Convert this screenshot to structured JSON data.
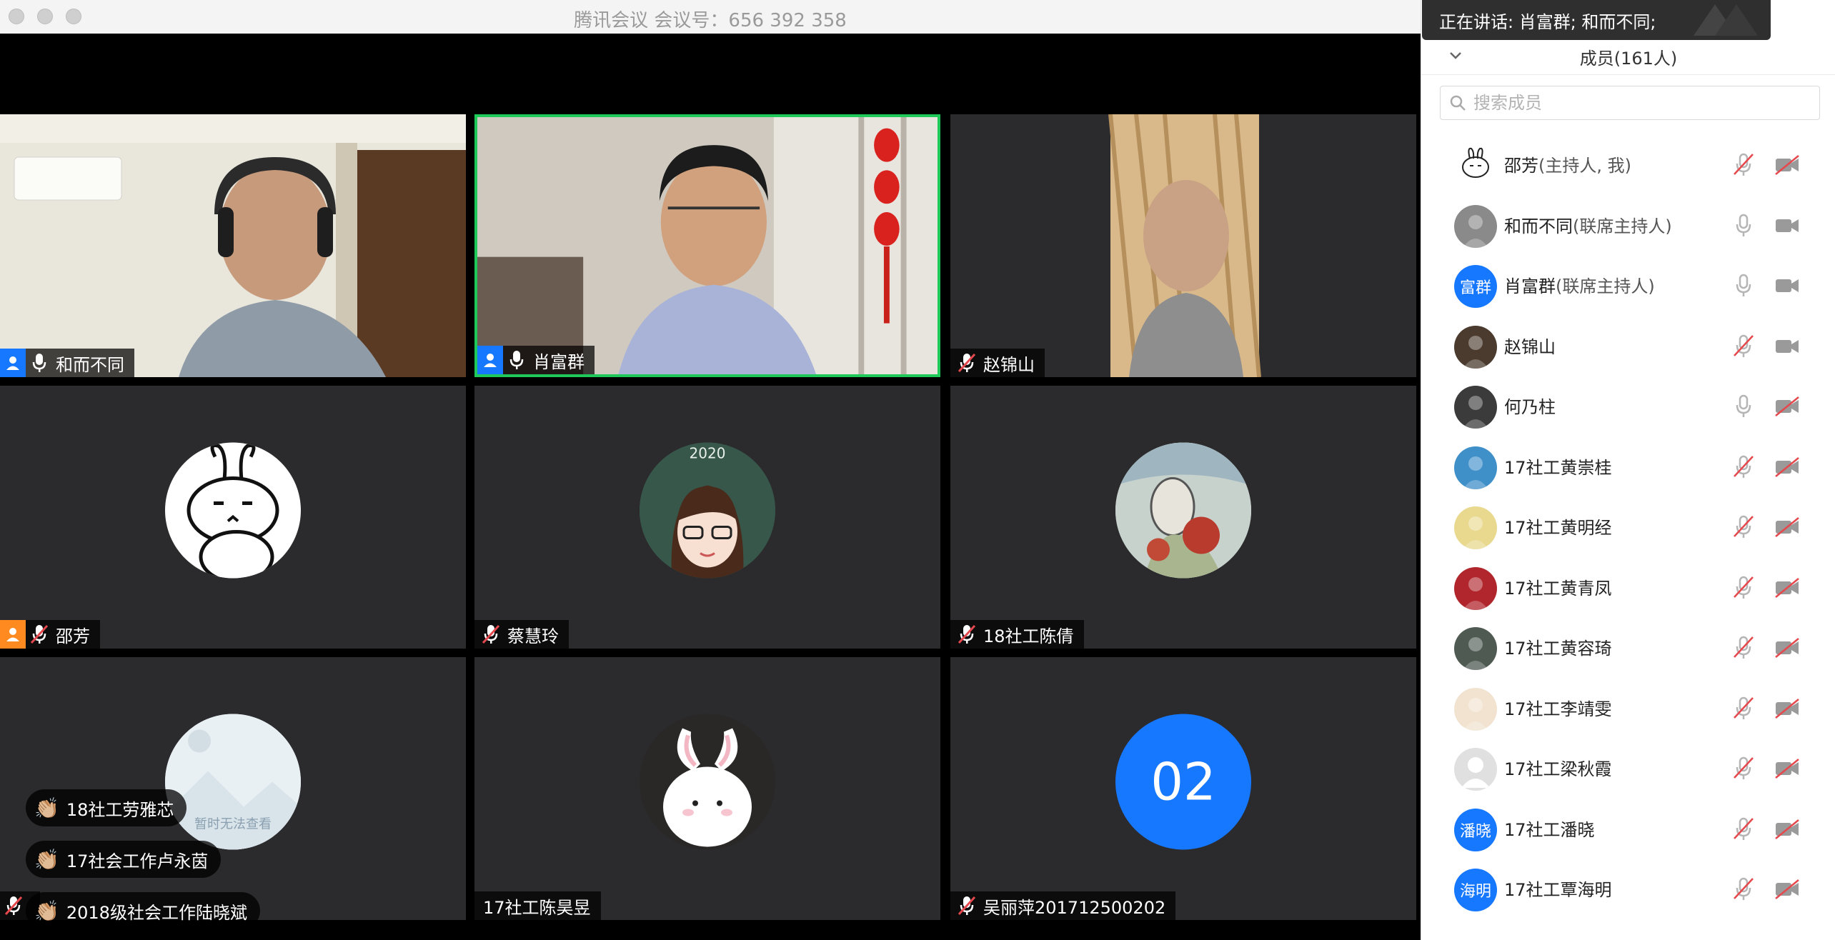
{
  "window": {
    "title": "腾讯会议 会议号：656 392 358"
  },
  "speaking_banner": {
    "text": "正在讲话: 肖富群; 和而不同;"
  },
  "members_panel": {
    "title": "成员(161人)",
    "search_placeholder": "搜索成员",
    "members": [
      {
        "name": "邵芳",
        "role": "(主持人, 我)",
        "avatar": "rabbit",
        "mic": "muted",
        "cam": "off"
      },
      {
        "name": "和而不同",
        "role": "(联席主持人)",
        "avatar": "photo-gray",
        "mic": "on",
        "cam": "on"
      },
      {
        "name": "肖富群",
        "role": "(联席主持人)",
        "avatar": "text",
        "avatar_text": "富群",
        "mic": "on",
        "cam": "on"
      },
      {
        "name": "赵锦山",
        "role": "",
        "avatar": "photo-dark",
        "mic": "muted",
        "cam": "on"
      },
      {
        "name": "何乃柱",
        "role": "",
        "avatar": "photo-person",
        "mic": "on",
        "cam": "off"
      },
      {
        "name": "17社工黄崇桂",
        "role": "",
        "avatar": "photo-sea",
        "mic": "muted",
        "cam": "off"
      },
      {
        "name": "17社工黄明经",
        "role": "",
        "avatar": "photo-field",
        "mic": "muted",
        "cam": "off"
      },
      {
        "name": "17社工黄青凤",
        "role": "",
        "avatar": "photo-red",
        "mic": "muted",
        "cam": "off"
      },
      {
        "name": "17社工黄容琦",
        "role": "",
        "avatar": "photo-land",
        "mic": "muted",
        "cam": "off"
      },
      {
        "name": "17社工李靖雯",
        "role": "",
        "avatar": "photo-light",
        "mic": "muted",
        "cam": "off"
      },
      {
        "name": "17社工梁秋霞",
        "role": "",
        "avatar": "default",
        "mic": "muted",
        "cam": "off"
      },
      {
        "name": "17社工潘晓",
        "role": "",
        "avatar": "text",
        "avatar_text": "潘晓",
        "mic": "muted",
        "cam": "off"
      },
      {
        "name": "17社工覃海明",
        "role": "",
        "avatar": "text",
        "avatar_text": "海明",
        "mic": "muted",
        "cam": "off"
      }
    ]
  },
  "tiles": [
    {
      "name": "和而不同",
      "tag": "blue",
      "mic": "on",
      "type": "video1"
    },
    {
      "name": "肖富群",
      "tag": "blue",
      "mic": "on",
      "type": "video2",
      "speaking": true
    },
    {
      "name": "赵锦山",
      "tag": "",
      "mic": "muted",
      "type": "video3"
    },
    {
      "name": "邵芳",
      "tag": "orange",
      "mic": "muted",
      "type": "avatar-rabbit"
    },
    {
      "name": "蔡慧玲",
      "tag": "",
      "mic": "muted",
      "type": "avatar-girl",
      "avatar_text": "2020"
    },
    {
      "name": "18社工陈倩",
      "tag": "",
      "mic": "muted",
      "type": "avatar-art"
    },
    {
      "name": "",
      "tag": "",
      "mic": "muted",
      "type": "avatar-placeholder",
      "avatar_text": "暂时无法查看"
    },
    {
      "name": "17社工陈昊昱",
      "tag": "",
      "mic": "",
      "type": "avatar-bunny"
    },
    {
      "name": "吴丽萍201712500202",
      "tag": "",
      "mic": "muted",
      "type": "avatar-number",
      "avatar_text": "02"
    }
  ],
  "reactions": [
    {
      "emoji": "👏🏼",
      "name": "18社工劳雅芯"
    },
    {
      "emoji": "👏🏼",
      "name": "17社会工作卢永茵"
    },
    {
      "emoji": "👏🏼",
      "name": "2018级社会工作陆晓斌"
    }
  ],
  "colors": {
    "speaking_border": "#1ec95a",
    "host_tag": "#1677ff",
    "self_tag": "#ff8a1f",
    "muted_icon": "#e5484d",
    "tile_bg": "#2b2b2d"
  }
}
